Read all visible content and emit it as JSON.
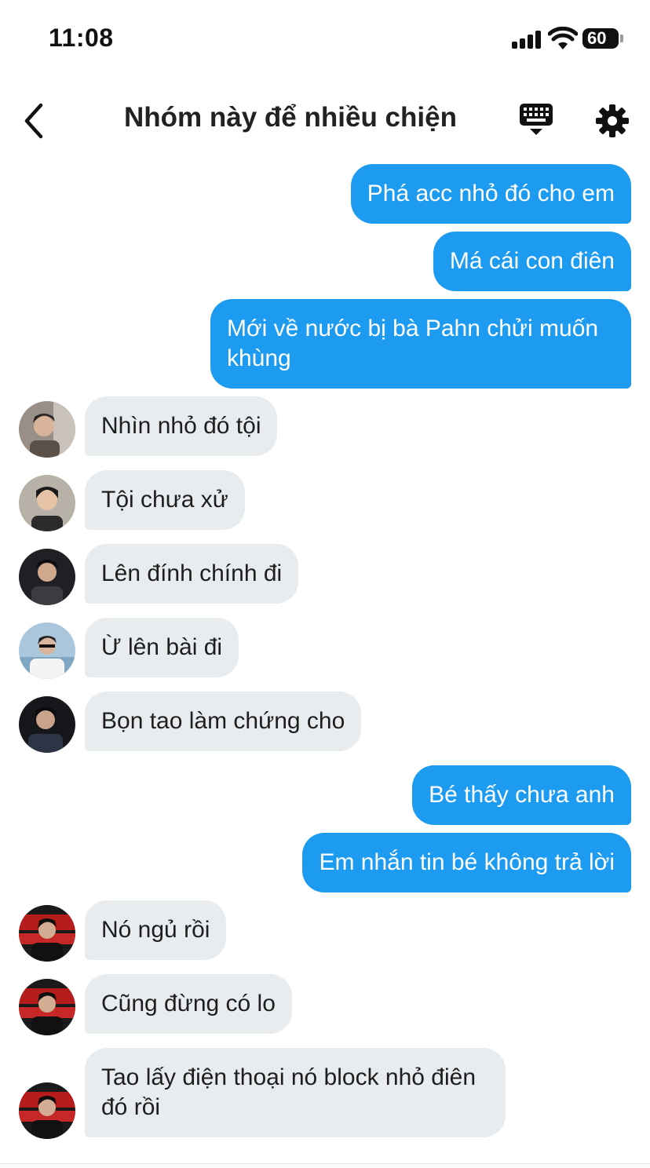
{
  "status_bar": {
    "time": "11:08",
    "battery": "60"
  },
  "header": {
    "title": "Nhóm này để nhiều chiện"
  },
  "icons": {
    "back": "chevron-left-icon",
    "keyboard": "keyboard-icon",
    "settings": "gear-icon"
  },
  "colors": {
    "outgoing": "#1d9bf0",
    "incoming": "#e8ecef"
  },
  "messages": [
    {
      "from": "me",
      "text": "Phá acc nhỏ đó cho em"
    },
    {
      "from": "me",
      "text": "Má cái con điên"
    },
    {
      "from": "me",
      "text": "Mới về nước bị bà Pahn chửi muốn khùng"
    },
    {
      "from": "other",
      "text": "Nhìn nhỏ đó tội"
    },
    {
      "from": "other",
      "text": "Tội chưa xử"
    },
    {
      "from": "other",
      "text": "Lên đính chính đi"
    },
    {
      "from": "other",
      "text": "Ừ lên bài đi"
    },
    {
      "from": "other",
      "text": "Bọn tao làm chứng cho"
    },
    {
      "from": "me",
      "text": "Bé thấy chưa anh"
    },
    {
      "from": "me",
      "text": "Em nhắn tin bé không trả lời"
    },
    {
      "from": "other",
      "text": "Nó ngủ rồi"
    },
    {
      "from": "other",
      "text": "Cũng đừng có lo"
    },
    {
      "from": "other",
      "text": "Tao lấy điện thoại nó block nhỏ điên đó rồi"
    }
  ]
}
